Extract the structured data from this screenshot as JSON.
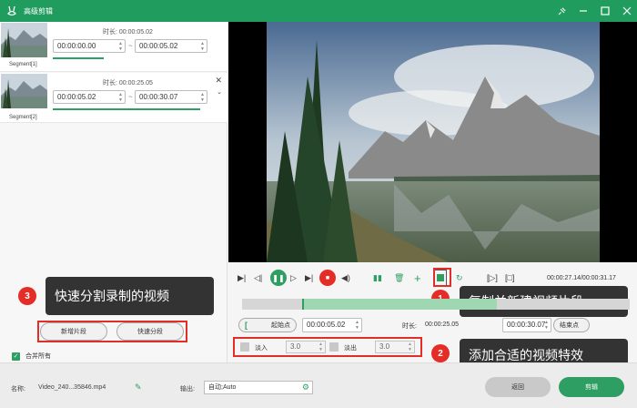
{
  "window": {
    "title": "高级剪辑",
    "logo_icon": "rabbit-logo-icon"
  },
  "colors": {
    "brand": "#1f9c5e",
    "accent": "#2e9e62",
    "highlight": "#e52d27",
    "callout_bg": "#333333"
  },
  "segments": [
    {
      "label": "Segment[1]",
      "duration_label": "时长:",
      "duration": "00:00:05.02",
      "start": "00:00:00.00",
      "end": "00:00:05.02"
    },
    {
      "label": "Segment[2]",
      "duration_label": "时长:",
      "duration": "00:00:25.05",
      "start": "00:00:05.02",
      "end": "00:00:30.07"
    }
  ],
  "callouts": [
    {
      "num": "3",
      "text": "快速分割录制的视频"
    },
    {
      "num": "1",
      "text": "复制并新建视频片段"
    },
    {
      "num": "2",
      "text": "添加合适的视频特效"
    }
  ],
  "left_actions": {
    "new_segment": "新增片段",
    "quick_split": "快速分段",
    "merge_all": "合并所有"
  },
  "player": {
    "time_display": "00:00:27.14/00:00:31.17"
  },
  "range": {
    "start_btn": "起始点",
    "start_time": "00:00:05.02",
    "duration_label": "时长:",
    "duration": "00:00:25.05",
    "end_time": "00:00:30.07",
    "end_btn": "结束点"
  },
  "effects": {
    "fade_in_label": "淡入",
    "fade_in_value": "3.0",
    "fade_out_label": "淡出",
    "fade_out_value": "3.0"
  },
  "bottom": {
    "name_label": "名称:",
    "file_name": "Video_240...35846.mp4",
    "output_label": "输出:",
    "output_value": "自动;Auto",
    "back_label": "返回",
    "edit_label": "剪辑"
  }
}
